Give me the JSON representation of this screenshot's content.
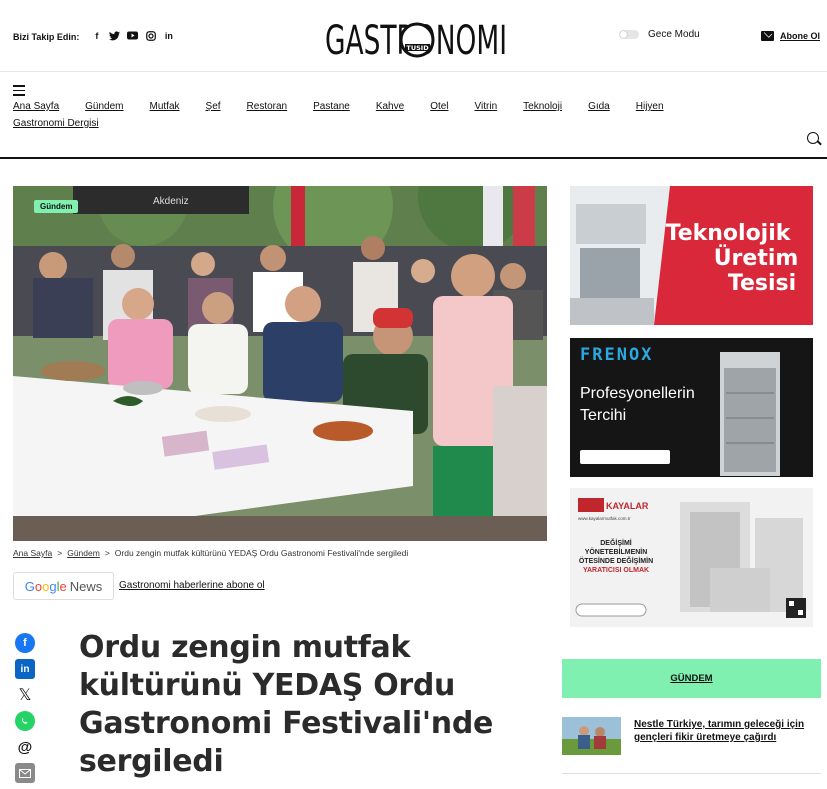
{
  "header": {
    "follow_label": "Bizi Takip Edin:",
    "social_icons": [
      "facebook-icon",
      "twitter-icon",
      "youtube-icon",
      "instagram-icon",
      "linkedin-icon"
    ],
    "logo_text": "GASTRONOMI",
    "logo_sub": "TUSID",
    "night_mode_label": "Gece Modu",
    "subscribe_label": "Abone Ol"
  },
  "nav": {
    "items": [
      "Ana Sayfa",
      "Gündem",
      "Mutfak",
      "Şef",
      "Restoran",
      "Pastane",
      "Kahve",
      "Otel",
      "Vitrin",
      "Teknoloji",
      "Gıda",
      "Hijyen"
    ],
    "items_row2": "Gastronomi Dergisi"
  },
  "article": {
    "category_badge": "Gündem",
    "breadcrumb": [
      "Ana Sayfa",
      "Gündem",
      "Ordu zengin mutfak kültürünü YEDAŞ Ordu Gastronomi Festivali'nde sergiledi"
    ],
    "google_news_link": "Gastronomi haberlerine abone ol",
    "title": "Ordu zengin mutfak kültürünü YEDAŞ Ordu Gastronomi Festivali'nde sergiledi",
    "hero_sign_text": "Akdeniz"
  },
  "sidebar": {
    "ad1": {
      "line1": "Teknolojik",
      "line2": "Üretim",
      "line3": "Tesisi"
    },
    "ad2": {
      "brand": "FRENOX",
      "line1": "Profesyonellerin",
      "line2": "Tercihi"
    },
    "ad3": {
      "brand": "KAYALAR",
      "line1": "DEĞİŞİMİ",
      "line2": "YÖNETEBİLMENİN",
      "line3": "ÖTESİNDE DEĞİŞİMİN",
      "line4": "YARATICISI OLMAK",
      "site": "www.kayalarmutfak.com.tr"
    },
    "section_label": "GÜNDEM",
    "news_items": [
      {
        "title": "Nestle Türkiye, tarımın geleceği için gençleri fikir üretmeye çağırdı"
      }
    ]
  },
  "colors": {
    "accent_green": "#7ff0b0",
    "ad_red": "#d8283a",
    "facebook": "#1877f2",
    "linkedin": "#0a66c2",
    "x": "#111111",
    "whatsapp": "#25d366",
    "threads": "#111111",
    "email": "#888888"
  }
}
